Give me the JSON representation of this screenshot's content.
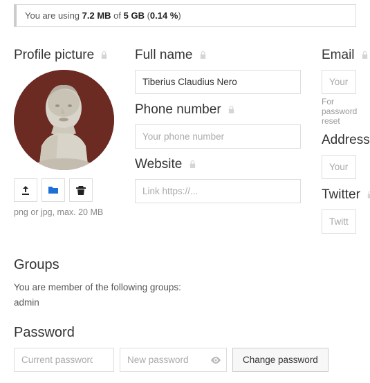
{
  "storage": {
    "prefix": "You are using ",
    "used": "7.2 MB",
    "mid": " of ",
    "total": "5 GB",
    "pct_open": " (",
    "pct": "0.14 %",
    "pct_close": ")"
  },
  "profile_picture": {
    "label": "Profile picture",
    "hint": "png or jpg, max. 20 MB"
  },
  "full_name": {
    "label": "Full name",
    "value": "Tiberius Claudius Nero"
  },
  "phone": {
    "label": "Phone number",
    "placeholder": "Your phone number"
  },
  "website": {
    "label": "Website",
    "placeholder": "Link https://..."
  },
  "email": {
    "label": "Email",
    "placeholder": "Your email address",
    "hint": "For password reset"
  },
  "address": {
    "label": "Address",
    "placeholder": "Your postal address"
  },
  "twitter": {
    "label": "Twitter",
    "placeholder": "Twitter handle @..."
  },
  "groups": {
    "heading": "Groups",
    "intro": "You are member of the following groups:",
    "list": "admin"
  },
  "password": {
    "heading": "Password",
    "current_placeholder": "Current password",
    "new_placeholder": "New password",
    "button": "Change password"
  }
}
